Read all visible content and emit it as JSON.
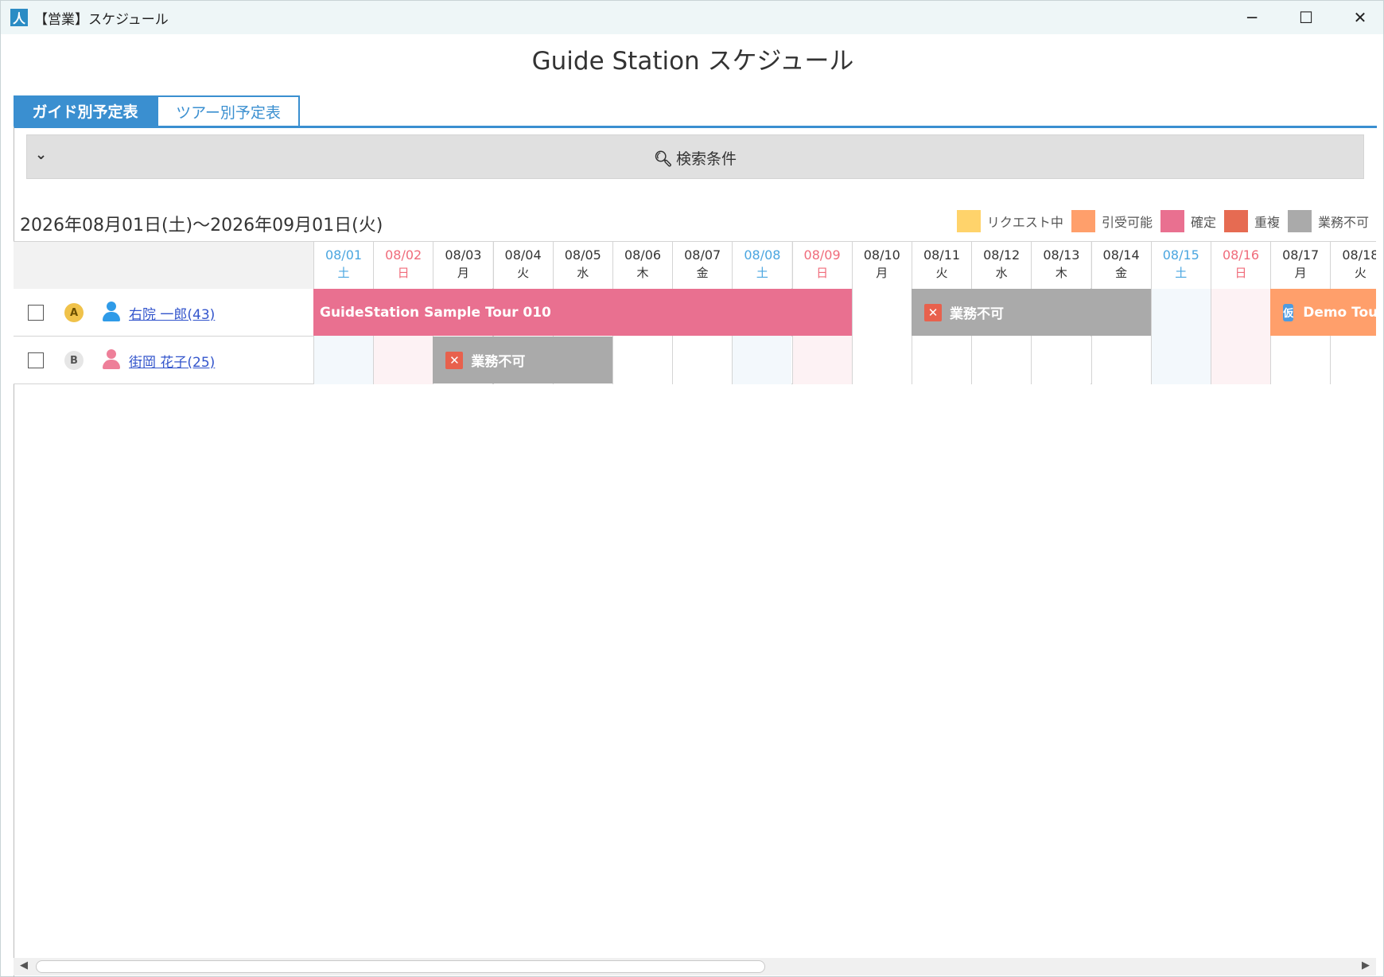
{
  "window": {
    "title": "【営業】スケジュール",
    "app_icon": "人"
  },
  "page_title": "Guide Station スケジュール",
  "tabs": [
    {
      "label": "ガイド別予定表",
      "active": true
    },
    {
      "label": "ツアー別予定表",
      "active": false
    }
  ],
  "search": {
    "label": "検索条件",
    "toggle_icon": "chevron-down-icon"
  },
  "date_range": "2026年08月01日(土)～2026年09月01日(火)",
  "legend": [
    {
      "label": "リクエスト中",
      "color": "#ffd36b"
    },
    {
      "label": "引受可能",
      "color": "#ff9f6b"
    },
    {
      "label": "確定",
      "color": "#e97090"
    },
    {
      "label": "重複",
      "color": "#e66b52"
    },
    {
      "label": "業務不可",
      "color": "#aaaaaa"
    }
  ],
  "days": [
    {
      "date": "08/01",
      "dow": "土",
      "type": "sat"
    },
    {
      "date": "08/02",
      "dow": "日",
      "type": "sun"
    },
    {
      "date": "08/03",
      "dow": "月",
      "type": "wk"
    },
    {
      "date": "08/04",
      "dow": "火",
      "type": "wk"
    },
    {
      "date": "08/05",
      "dow": "水",
      "type": "wk"
    },
    {
      "date": "08/06",
      "dow": "木",
      "type": "wk"
    },
    {
      "date": "08/07",
      "dow": "金",
      "type": "wk"
    },
    {
      "date": "08/08",
      "dow": "土",
      "type": "sat"
    },
    {
      "date": "08/09",
      "dow": "日",
      "type": "sun"
    },
    {
      "date": "08/10",
      "dow": "月",
      "type": "wk"
    },
    {
      "date": "08/11",
      "dow": "火",
      "type": "wk"
    },
    {
      "date": "08/12",
      "dow": "水",
      "type": "wk"
    },
    {
      "date": "08/13",
      "dow": "木",
      "type": "wk"
    },
    {
      "date": "08/14",
      "dow": "金",
      "type": "wk"
    },
    {
      "date": "08/15",
      "dow": "土",
      "type": "sat"
    },
    {
      "date": "08/16",
      "dow": "日",
      "type": "sun"
    },
    {
      "date": "08/17",
      "dow": "月",
      "type": "wk"
    },
    {
      "date": "08/18",
      "dow": "火",
      "type": "wk"
    }
  ],
  "guides": [
    {
      "badge": "A",
      "badge_color": "#f0c24a",
      "badge_text_color": "#6b4f00",
      "gender_color": "#2f9be8",
      "name": "右院 一郎(43)",
      "events": [
        {
          "label": "GuideStation Sample Tour 010",
          "start": 0,
          "days": 9,
          "color": "#e97090",
          "icon": ""
        },
        {
          "label": "業務不可",
          "start": 10,
          "days": 4,
          "color": "#aaaaaa",
          "icon": "x"
        },
        {
          "label": "Demo Tour",
          "start": 16,
          "days": 2,
          "color": "#ff9f6b",
          "icon": "仮"
        }
      ]
    },
    {
      "badge": "B",
      "badge_color": "#e6e6e6",
      "badge_text_color": "#555555",
      "gender_color": "#ee7f99",
      "name": "街岡 花子(25)",
      "events": [
        {
          "label": "業務不可",
          "start": 2,
          "days": 3,
          "color": "#aaaaaa",
          "icon": "x"
        }
      ]
    }
  ],
  "colors": {
    "accent": "#3a8fd0",
    "saturday": "#4aa6e0",
    "sunday": "#f06b7a"
  }
}
